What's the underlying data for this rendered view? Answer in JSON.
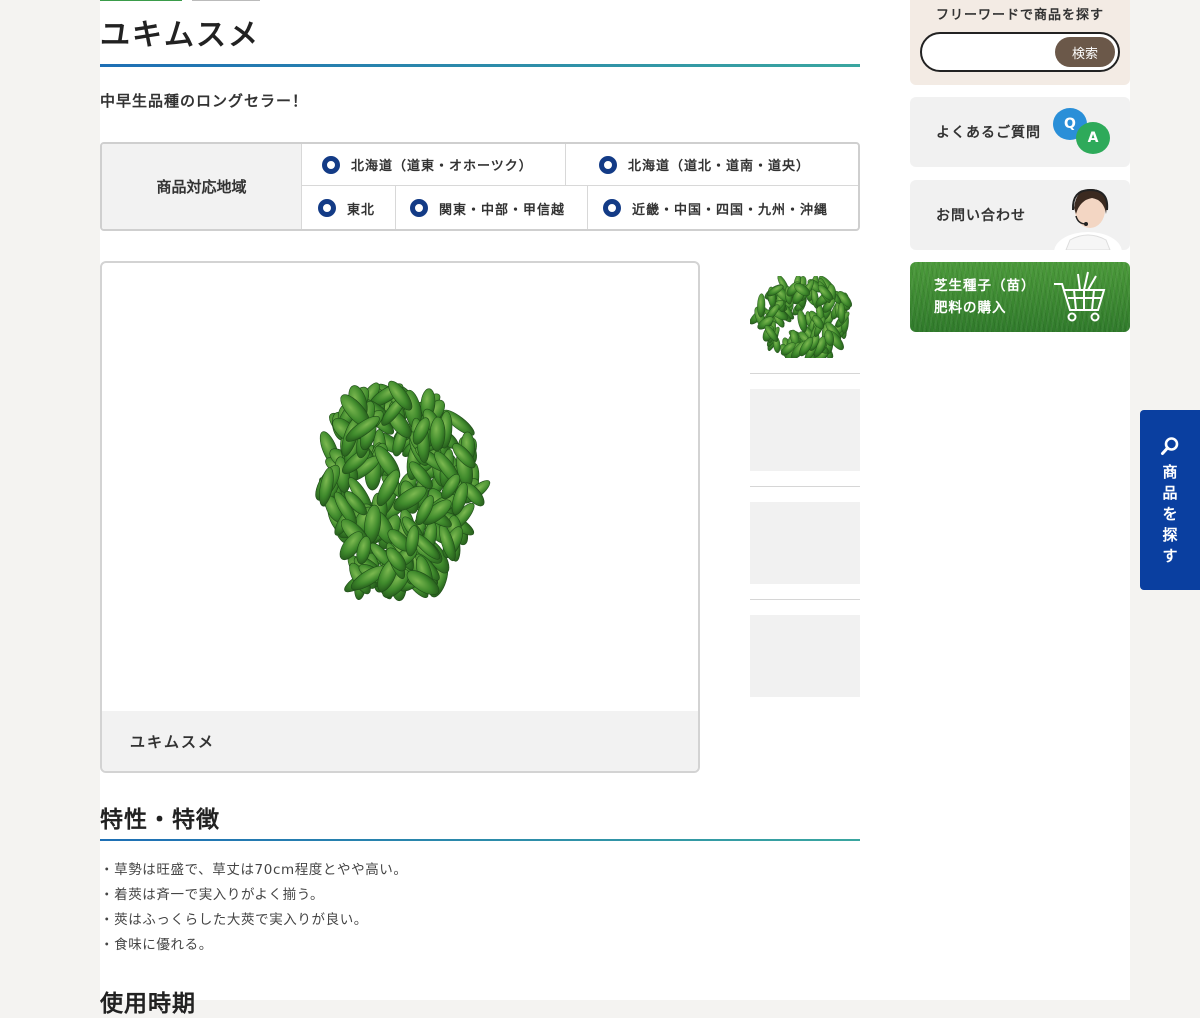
{
  "product": {
    "title": "ユキムスメ",
    "catchphrase": "中早生品種のロングセラー！"
  },
  "regions": {
    "heading": "商品対応地域",
    "items": [
      "北海道（道東・オホーツク）",
      "北海道（道北・道南・道央）",
      "東北",
      "関東・中部・甲信越",
      "近畿・中国・四国・九州・沖縄"
    ]
  },
  "gallery": {
    "main_caption": "ユキムスメ",
    "thumbnail_count": 4
  },
  "features": {
    "heading": "特性・特徴",
    "items": [
      "・草勢は旺盛で、草丈は70cm程度とやや高い。",
      "・着莢は斉一で実入りがよく揃う。",
      "・莢はふっくらした大莢で実入りが良い。",
      "・食味に優れる。"
    ]
  },
  "next_section": {
    "heading": "使用時期"
  },
  "sidebar": {
    "search": {
      "label": "フリーワードで商品を探す",
      "value": "",
      "button_label": "検索"
    },
    "faq": {
      "label": "よくあるご質問",
      "q_badge": "Q",
      "a_badge": "A"
    },
    "contact": {
      "label": "お問い合わせ"
    },
    "purchase": {
      "line1": "芝生種子（苗）",
      "line2": "肥料の購入"
    }
  },
  "floating_tab": {
    "label": "商品を探す"
  },
  "colors": {
    "accent_navy": "#133b86",
    "float_tab_blue": "#0a3fa0",
    "rule_gradient_start": "#1e6fb5",
    "rule_gradient_end": "#3aa6a0",
    "search_button": "#6b5849"
  },
  "icons": [
    "search-icon",
    "qa-icon",
    "operator-icon",
    "cart-icon",
    "radio-icon"
  ]
}
